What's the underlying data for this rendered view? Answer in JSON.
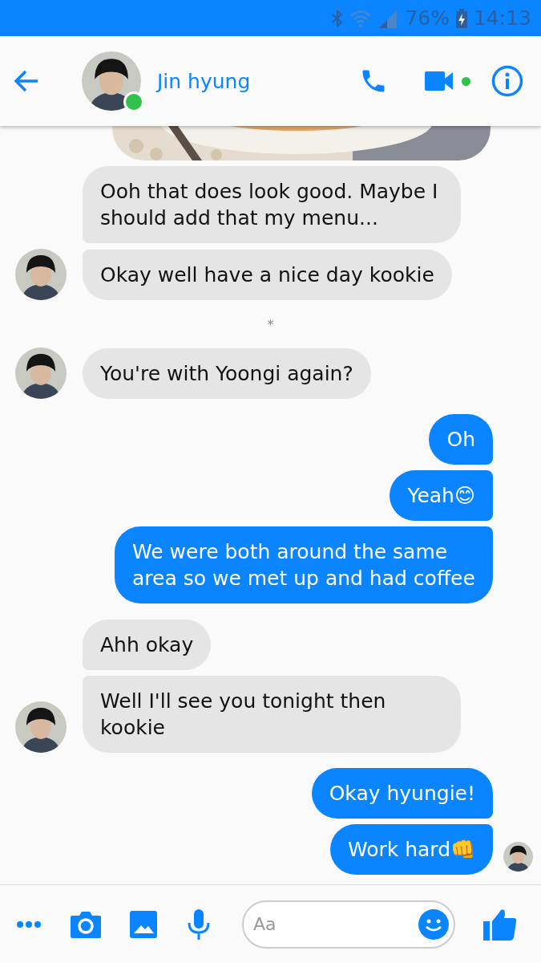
{
  "status_bar": {
    "battery": "76%",
    "time": "14:13"
  },
  "header": {
    "name": "Jin hyung",
    "online": true,
    "video_active": true
  },
  "messages": [
    {
      "kind": "picture"
    },
    {
      "kind": "incoming",
      "text": "Ooh that does look good. Maybe I should add that my menu...",
      "avatar": false
    },
    {
      "kind": "incoming",
      "text": "Okay well have a nice day kookie",
      "avatar": true
    },
    {
      "kind": "divider",
      "text": "*"
    },
    {
      "kind": "incoming",
      "text": "You're with Yoongi again?",
      "avatar": true
    },
    {
      "kind": "outgoing",
      "text": "Oh",
      "seen": false
    },
    {
      "kind": "outgoing",
      "text": "Yeah😊",
      "seen": false
    },
    {
      "kind": "outgoing",
      "text": "We were both around the same area so we met up and had coffee",
      "seen": false
    },
    {
      "kind": "incoming",
      "text": "Ahh okay",
      "avatar": false
    },
    {
      "kind": "incoming",
      "text": "Well I'll see you tonight then kookie",
      "avatar": true
    },
    {
      "kind": "outgoing",
      "text": "Okay hyungie!",
      "seen": false
    },
    {
      "kind": "outgoing",
      "text": "Work hard👊",
      "seen": true
    }
  ],
  "composer": {
    "placeholder": "Aa"
  }
}
